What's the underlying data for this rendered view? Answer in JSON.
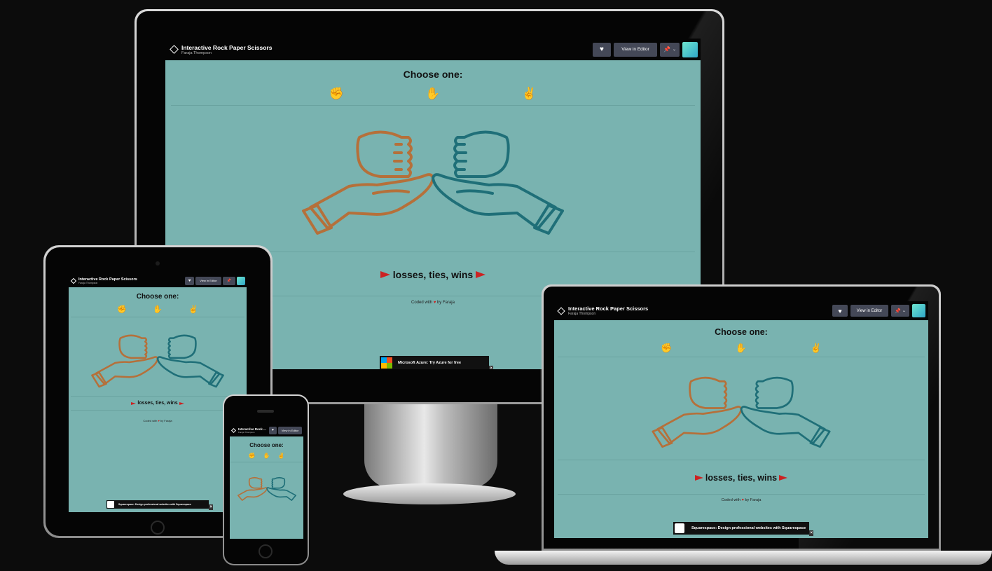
{
  "pen": {
    "title": "Interactive Rock Paper Scissors",
    "title_short": "Interactive Rock ...",
    "author": "Faraja Thompson",
    "view_editor_label": "View in Editor",
    "heart_icon": "heart-icon",
    "pin_icon": "pin-icon",
    "chevron_icon": "chevron-down-icon"
  },
  "game": {
    "choose_label": "Choose one:",
    "choices": [
      "rock",
      "paper",
      "scissors"
    ],
    "score_text": "losses, ties, wins",
    "footer_prefix": "Coded with",
    "footer_suffix": "by Faraja"
  },
  "ads": {
    "azure": "Microsoft Azure: Try Azure for free",
    "squarespace": "Squarespace: Design professional websites with Squarespace"
  },
  "colors": {
    "background": "#79b3b0",
    "left_hand": "#b5703a",
    "right_hand": "#1f6f78",
    "flag": "#cc2222"
  }
}
